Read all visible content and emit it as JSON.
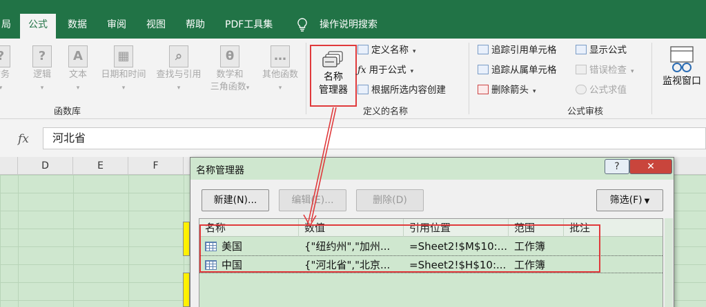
{
  "tabs": [
    "局",
    "公式",
    "数据",
    "审阅",
    "视图",
    "帮助",
    "PDF工具集",
    "操作说明搜索"
  ],
  "active_tab": "公式",
  "ribbon": {
    "function_library": {
      "buttons": [
        {
          "label1": "财务",
          "icon": "?",
          "name": "finance"
        },
        {
          "label1": "逻辑",
          "icon": "?",
          "name": "logic"
        },
        {
          "label1": "文本",
          "icon": "A",
          "name": "text"
        },
        {
          "label1": "日期和时间",
          "icon": "▦",
          "name": "datetime"
        },
        {
          "label1": "查找与引用",
          "icon": "⌕",
          "name": "lookup"
        },
        {
          "label1": "数学和",
          "label2": "三角函数",
          "icon": "θ",
          "name": "math"
        },
        {
          "label1": "其他函数",
          "icon": "…",
          "name": "more"
        }
      ],
      "group_label": "函数库"
    },
    "name_manager": {
      "line1": "名称",
      "line2": "管理器"
    },
    "defined_names": {
      "define_name": "定义名称",
      "use_in_formula": "用于公式",
      "create_from_selection": "根据所选内容创建",
      "group_label": "定义的名称"
    },
    "formula_auditing": {
      "trace_precedents": "追踪引用单元格",
      "trace_dependents": "追踪从属单元格",
      "remove_arrows": "删除箭头",
      "show_formulas": "显示公式",
      "error_checking": "错误检查",
      "evaluate_formula": "公式求值",
      "group_label": "公式审核"
    },
    "watch_window": "监视窗口"
  },
  "formula_bar": {
    "fx": "fx",
    "value": "河北省"
  },
  "columns": [
    "D",
    "E",
    "F"
  ],
  "dialog": {
    "title": "名称管理器",
    "help": "?",
    "close": "✕",
    "buttons": {
      "new": "新建(N)...",
      "edit": "编辑(E)...",
      "delete": "删除(D)",
      "filter": "筛选(F)"
    },
    "headers": [
      "名称",
      "数值",
      "引用位置",
      "范围",
      "批注"
    ],
    "rows": [
      {
        "name": "美国",
        "value": "{\"纽约州\",\"加州...",
        "ref": "=Sheet2!$M$10:...",
        "scope": "工作簿",
        "note": ""
      },
      {
        "name": "中国",
        "value": "{\"河北省\",\"北京...",
        "ref": "=Sheet2!$H$10:...",
        "scope": "工作簿",
        "note": ""
      }
    ]
  },
  "colors": {
    "excel_green": "#217346",
    "highlight_red": "#e0393b",
    "sheet_bg": "#cfe7cf"
  }
}
